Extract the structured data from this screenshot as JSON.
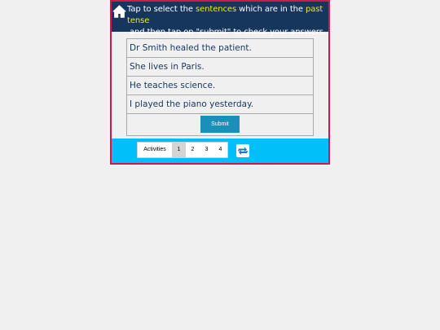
{
  "header": {
    "home_icon": "home-icon",
    "instruction": {
      "part1": "Tap to select the ",
      "highlight1": "sentences",
      "part2": " which are in the ",
      "highlight2": "past tense",
      "line2": "and then tap on \"submit\" to check your answers."
    },
    "highlight_color": "#e8f000",
    "background_color": "#17365e"
  },
  "sentences": [
    "Dr Smith healed the patient.",
    "She lives in Paris.",
    "He teaches science.",
    "I played the piano yesterday."
  ],
  "submit_label": "Submit",
  "footer": {
    "activities_label": "Activities",
    "pages": [
      "1",
      "2",
      "3",
      "4"
    ],
    "active_page": "1",
    "refresh_icon": "refresh-icon",
    "background_color": "#00bff9"
  },
  "frame_border_color": "#d0184e"
}
